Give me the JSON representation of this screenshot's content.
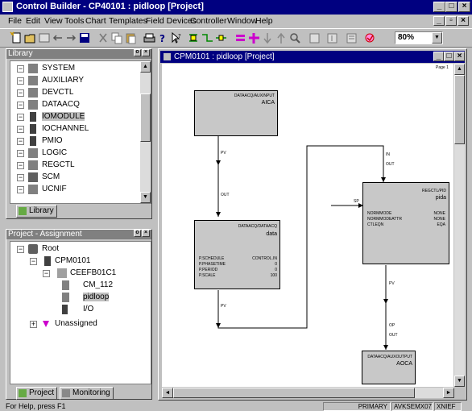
{
  "app": {
    "title": "Control Builder - CP40101 : pidloop [Project]"
  },
  "menu": [
    "File",
    "Edit",
    "View",
    "Tools",
    "Chart",
    "Templates",
    "Field Devices",
    "Controller",
    "Window",
    "Help"
  ],
  "toolbar": {
    "zoom": "80%"
  },
  "library": {
    "title": "Library",
    "items": [
      "SYSTEM",
      "AUXILIARY",
      "DEVCTL",
      "DATAACQ",
      "IOMODULE",
      "IOCHANNEL",
      "PMIO",
      "LOGIC",
      "REGCTL",
      "SCM",
      "UCNIF"
    ],
    "tab": "Library"
  },
  "project": {
    "title": "Project - Assignment",
    "tree": {
      "root": "Root",
      "cpm": "CPM0101",
      "cee": "CEEFB01C1",
      "cm1": "CM_112",
      "cm2": "pidloop",
      "io": "I/O",
      "unassigned": "Unassigned"
    },
    "tabs": [
      "Project",
      "Monitoring"
    ]
  },
  "diagram": {
    "title": "CPM0101 : pidloop [Project]",
    "page": "Page 1",
    "blocks": {
      "aica": {
        "type": "DATAACQ/AUXINPUT",
        "name": "AICA"
      },
      "data": {
        "type": "DATAACQ/DATAACQ",
        "name": "data",
        "params": [
          [
            "P.SCHEDULE",
            "CONTROL.IN"
          ],
          [
            "P.PHASETIME",
            "0"
          ],
          [
            "P.PERIOD",
            "0"
          ],
          [
            "P.SCALE",
            "100"
          ]
        ]
      },
      "pid": {
        "type": "REGCTL/PID",
        "name": "pida",
        "params": [
          [
            "NORMMODE",
            "NONE"
          ],
          [
            "NORMMODEATTR",
            "NONE"
          ],
          [
            "CTLEQN",
            "EQA"
          ]
        ]
      },
      "aoca": {
        "type": "DATAACQ/AUXOUTPUT",
        "name": "AOCA"
      }
    },
    "wire_labels": [
      "PV",
      "OUT",
      "PV",
      "IN",
      "OUT",
      "PV",
      "SP",
      "OP",
      "OUT"
    ]
  },
  "status": {
    "help": "For Help, press F1",
    "p1": "PRIMARY",
    "p2": "AVKSEMX07",
    "p3": "XNIEF"
  }
}
